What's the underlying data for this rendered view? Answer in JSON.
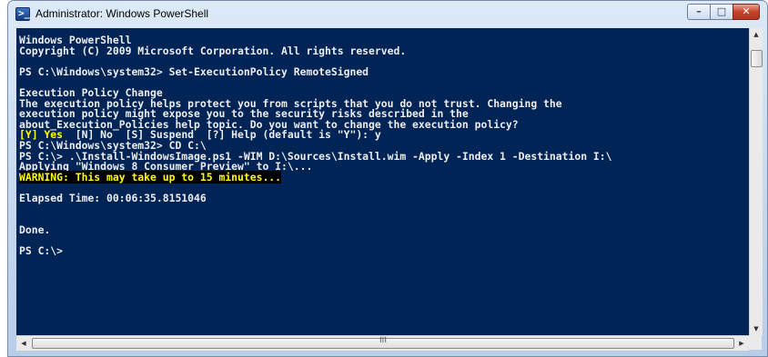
{
  "window": {
    "title": "Administrator: Windows PowerShell",
    "controls": {
      "minimize": "–",
      "maximize": "□",
      "close": "✕"
    }
  },
  "console": {
    "lines": [
      "Windows PowerShell",
      "Copyright (C) 2009 Microsoft Corporation. All rights reserved.",
      "",
      "PS C:\\Windows\\system32> Set-ExecutionPolicy RemoteSigned",
      "",
      "Execution Policy Change",
      "The execution policy helps protect you from scripts that you do not trust. Changing the",
      "execution policy might expose you to the security risks described in the",
      "about_Execution_Policies help topic. Do you want to change the execution policy?",
      "[Y] Yes  [N] No  [S] Suspend  [?] Help (default is \"Y\"): y",
      "PS C:\\Windows\\system32> CD C:\\",
      "PS C:\\> .\\Install-WindowsImage.ps1 -WIM D:\\Sources\\Install.wim -Apply -Index 1 -Destination I:\\",
      "Applying \"Windows 8 Consumer Preview\" to I:\\...",
      "WARNING: This may take up to 15 minutes...",
      "",
      "Elapsed Time: 00:06:35.8151046",
      "",
      "",
      "Done.",
      "",
      "PS C:\\>"
    ],
    "prompt_choice": {
      "highlight": "[Y] Yes",
      "rest": "  [N] No  [S] Suspend  [?] Help (default is \"Y\"): y"
    },
    "warning": "WARNING: This may take up to 15 minutes...",
    "colors": {
      "background": "#012456",
      "text": "#eeedf0",
      "highlight": "#ffff00",
      "warning_bg": "#000000"
    }
  },
  "scrollbars": {
    "horizontal_thumb": "III",
    "left_arrow": "◀",
    "right_arrow": "▶",
    "up_arrow": "▲",
    "down_arrow": "▼"
  }
}
